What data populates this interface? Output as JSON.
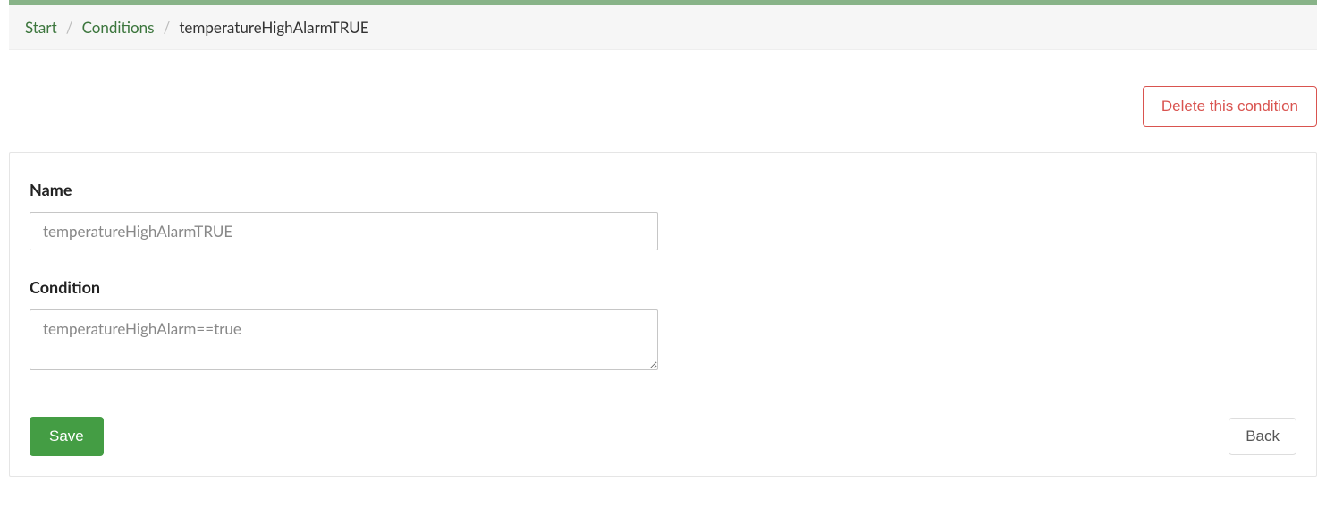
{
  "breadcrumb": {
    "start": "Start",
    "conditions": "Conditions",
    "current": "temperatureHighAlarmTRUE"
  },
  "actions": {
    "delete_label": "Delete this condition"
  },
  "form": {
    "name": {
      "label": "Name",
      "value": "temperatureHighAlarmTRUE"
    },
    "condition": {
      "label": "Condition",
      "value": "temperatureHighAlarm==true"
    }
  },
  "buttons": {
    "save": "Save",
    "back": "Back"
  }
}
